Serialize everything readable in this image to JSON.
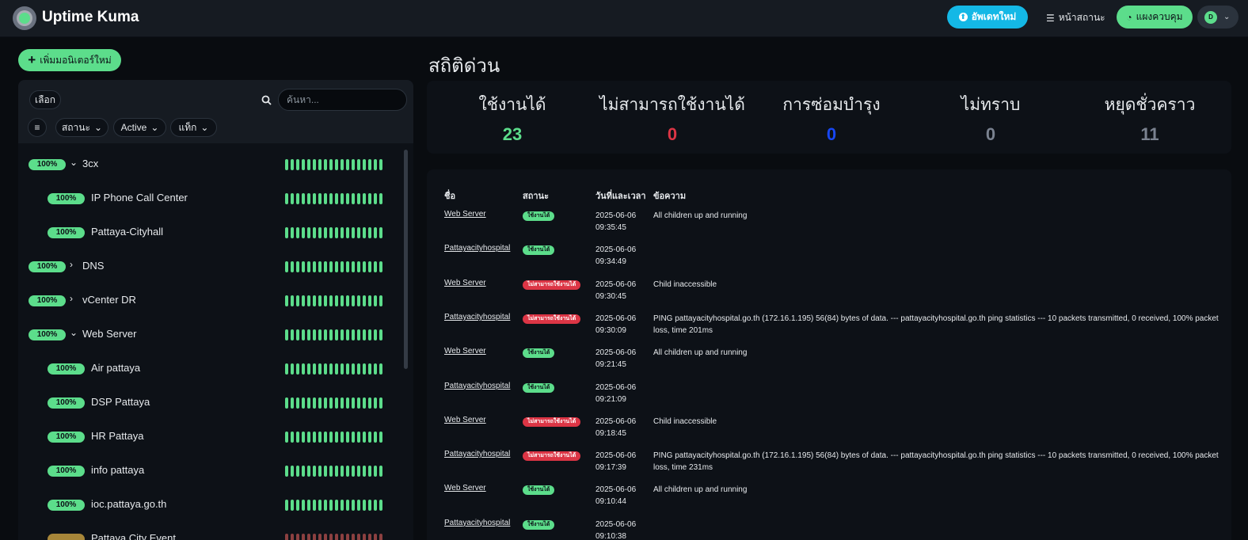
{
  "header": {
    "app_title": "Uptime Kuma",
    "update_label": "อัพเดทใหม่",
    "status_page_label": "หน้าสถานะ",
    "dashboard_label": "แผงควบคุม",
    "avatar_initial": "D"
  },
  "sidebar": {
    "add_monitor_label": "เพิ่มมอนิเตอร์ใหม่",
    "select_label": "เลือก",
    "search_placeholder": "ค้นหา...",
    "filters": {
      "status_label": "สถานะ",
      "active_label": "Active",
      "tags_label": "แท็ก"
    },
    "monitors": [
      {
        "name": "3cx",
        "uptime": "100%",
        "level": 0,
        "group": "expanded"
      },
      {
        "name": "IP Phone Call Center",
        "uptime": "100%",
        "level": 1,
        "group": "none"
      },
      {
        "name": "Pattaya-Cityhall",
        "uptime": "100%",
        "level": 1,
        "group": "none"
      },
      {
        "name": "DNS",
        "uptime": "100%",
        "level": 0,
        "group": "collapsed"
      },
      {
        "name": "vCenter DR",
        "uptime": "100%",
        "level": 0,
        "group": "collapsed"
      },
      {
        "name": "Web Server",
        "uptime": "100%",
        "level": 0,
        "group": "expanded"
      },
      {
        "name": "Air pattaya",
        "uptime": "100%",
        "level": 1,
        "group": "none"
      },
      {
        "name": "DSP Pattaya",
        "uptime": "100%",
        "level": 1,
        "group": "none"
      },
      {
        "name": "HR Pattaya",
        "uptime": "100%",
        "level": 1,
        "group": "none"
      },
      {
        "name": "info pattaya",
        "uptime": "100%",
        "level": 1,
        "group": "none"
      },
      {
        "name": "ioc.pattaya.go.th",
        "uptime": "100%",
        "level": 1,
        "group": "none"
      },
      {
        "name": "Pattaya City Event",
        "uptime": "",
        "level": 1,
        "group": "none"
      }
    ]
  },
  "main": {
    "section_title": "สถิติด่วน",
    "stats": [
      {
        "label": "ใช้งานได้",
        "value": "23",
        "color": "#5cdd8b"
      },
      {
        "label": "ไม่สามารถใช้งานได้",
        "value": "0",
        "color": "#dc3545"
      },
      {
        "label": "การซ่อมบำรุง",
        "value": "0",
        "color": "#1747f5"
      },
      {
        "label": "ไม่ทราบ",
        "value": "0",
        "color": "#7a8290"
      },
      {
        "label": "หยุดชั่วคราว",
        "value": "11",
        "color": "#7a8290"
      }
    ],
    "events_columns": {
      "name": "ชื่อ",
      "status": "สถานะ",
      "datetime": "วันที่และเวลา",
      "message": "ข้อความ"
    },
    "events": [
      {
        "name": "Web Server",
        "status": "ใช้งานได้",
        "kind": "up",
        "date": "2025-06-06",
        "time": "09:35:45",
        "message": "All children up and running"
      },
      {
        "name": "Pattayacityhospital",
        "status": "ใช้งานได้",
        "kind": "up",
        "date": "2025-06-06",
        "time": "09:34:49",
        "message": ""
      },
      {
        "name": "Web Server",
        "status": "ไม่สามารถใช้งานได้",
        "kind": "down",
        "date": "2025-06-06",
        "time": "09:30:45",
        "message": "Child inaccessible"
      },
      {
        "name": "Pattayacityhospital",
        "status": "ไม่สามารถใช้งานได้",
        "kind": "down",
        "date": "2025-06-06",
        "time": "09:30:09",
        "message": "PING pattayacityhospital.go.th (172.16.1.195) 56(84) bytes of data. --- pattayacityhospital.go.th ping statistics --- 10 packets transmitted, 0 received, 100% packet loss, time 201ms"
      },
      {
        "name": "Web Server",
        "status": "ใช้งานได้",
        "kind": "up",
        "date": "2025-06-06",
        "time": "09:21:45",
        "message": "All children up and running"
      },
      {
        "name": "Pattayacityhospital",
        "status": "ใช้งานได้",
        "kind": "up",
        "date": "2025-06-06",
        "time": "09:21:09",
        "message": ""
      },
      {
        "name": "Web Server",
        "status": "ไม่สามารถใช้งานได้",
        "kind": "down",
        "date": "2025-06-06",
        "time": "09:18:45",
        "message": "Child inaccessible"
      },
      {
        "name": "Pattayacityhospital",
        "status": "ไม่สามารถใช้งานได้",
        "kind": "down",
        "date": "2025-06-06",
        "time": "09:17:39",
        "message": "PING pattayacityhospital.go.th (172.16.1.195) 56(84) bytes of data. --- pattayacityhospital.go.th ping statistics --- 10 packets transmitted, 0 received, 100% packet loss, time 231ms"
      },
      {
        "name": "Web Server",
        "status": "ใช้งานได้",
        "kind": "up",
        "date": "2025-06-06",
        "time": "09:10:44",
        "message": "All children up and running"
      },
      {
        "name": "Pattayacityhospital",
        "status": "ใช้งานได้",
        "kind": "up",
        "date": "2025-06-06",
        "time": "09:10:38",
        "message": ""
      }
    ]
  }
}
